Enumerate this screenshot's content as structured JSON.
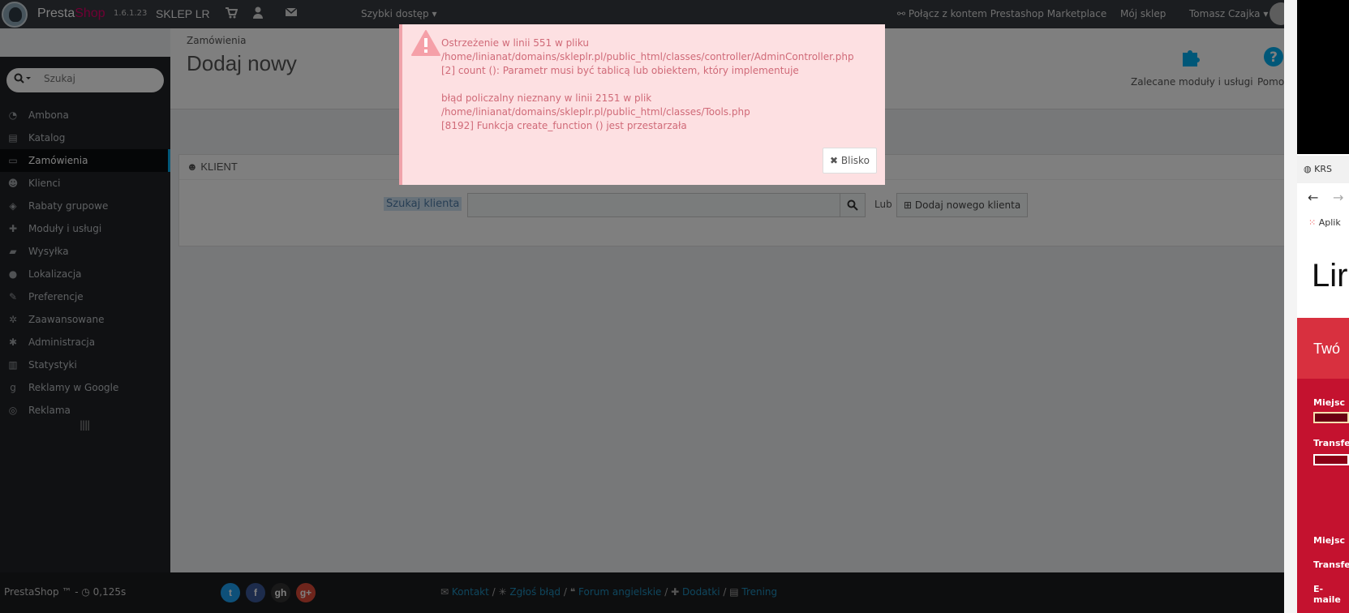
{
  "topbar": {
    "brand_presta": "Presta",
    "brand_shop": "Shop",
    "version": "1.6.1.23",
    "shop_name": "SKLEP LR",
    "quick_access": "Szybki dostęp",
    "connect_marketplace": "Połącz z kontem Prestashop Marketplace",
    "my_shop": "Mój sklep",
    "user_name": "Tomasz Czajka"
  },
  "sidebar": {
    "search_placeholder": "Szukaj",
    "items": [
      {
        "label": "Ambona",
        "icon": "dashboard-icon"
      },
      {
        "label": "Katalog",
        "icon": "book-icon"
      },
      {
        "label": "Zamówienia",
        "icon": "credit-card-icon"
      },
      {
        "label": "Klienci",
        "icon": "users-icon"
      },
      {
        "label": "Rabaty grupowe",
        "icon": "tags-icon"
      },
      {
        "label": "Moduły i usługi",
        "icon": "puzzle-icon"
      },
      {
        "label": "Wysyłka",
        "icon": "truck-icon"
      },
      {
        "label": "Lokalizacja",
        "icon": "globe-icon"
      },
      {
        "label": "Preferencje",
        "icon": "wrench-icon"
      },
      {
        "label": "Zaawansowane",
        "icon": "cogs-icon"
      },
      {
        "label": "Administracja",
        "icon": "gear-icon"
      },
      {
        "label": "Statystyki",
        "icon": "bar-chart-icon"
      },
      {
        "label": "Reklamy w Google",
        "icon": "google-icon"
      },
      {
        "label": "Reklama",
        "icon": "bullseye-icon"
      }
    ],
    "active_index": 2
  },
  "header": {
    "breadcrumb": "Zamówienia",
    "title": "Dodaj nowy",
    "recommended_modules": "Zalecane moduły i usługi",
    "help": "Pomoc"
  },
  "customer_panel": {
    "heading": "KLIENT",
    "search_label": "Szukaj klienta",
    "or_label": "Lub",
    "add_customer": "Dodaj nowego klienta"
  },
  "error_dialog": {
    "lines": [
      "Ostrzeżenie w linii 551 w pliku",
      "/home/linianat/domains/skleplr.pl/public_html/classes/controller/AdminController.php",
      "[2] count (): Parametr musi być tablicą lub obiektem, który implementuje",
      "",
      "błąd policzalny nieznany w linii 2151 w plik",
      "/home/linianat/domains/skleplr.pl/public_html/classes/Tools.php",
      "[8192] Funkcja create_function () jest przestarzała"
    ],
    "close_label": "Blisko",
    "text_color": "#d06a78",
    "bg_color": "#fde0e2"
  },
  "footer": {
    "powered": "PrestaShop ™ - ",
    "load_time": "0,125s",
    "social": [
      "t",
      "f",
      "gh",
      "g+"
    ],
    "links": [
      {
        "label": "Kontakt",
        "icon": "envelope-icon"
      },
      {
        "label": "Zgłoś błąd",
        "icon": "bug-icon"
      },
      {
        "label": "Forum angielskie",
        "icon": "comments-icon"
      },
      {
        "label": "Dodatki",
        "icon": "puzzle-icon"
      },
      {
        "label": "Trening",
        "icon": "book-icon"
      }
    ]
  },
  "right_window": {
    "tab_text": "KRS",
    "apps": "Aplik",
    "big_text": "Lir",
    "red_heading": "Twó",
    "labels": [
      "Miejsc",
      "Transfe",
      "Miejsc",
      "Transfe",
      "E-maile"
    ]
  },
  "colors": {
    "accent": "#00aff0",
    "brand_pink": "#df0067",
    "sidebar_bg": "#202226",
    "topbar_bg": "#363a41"
  }
}
